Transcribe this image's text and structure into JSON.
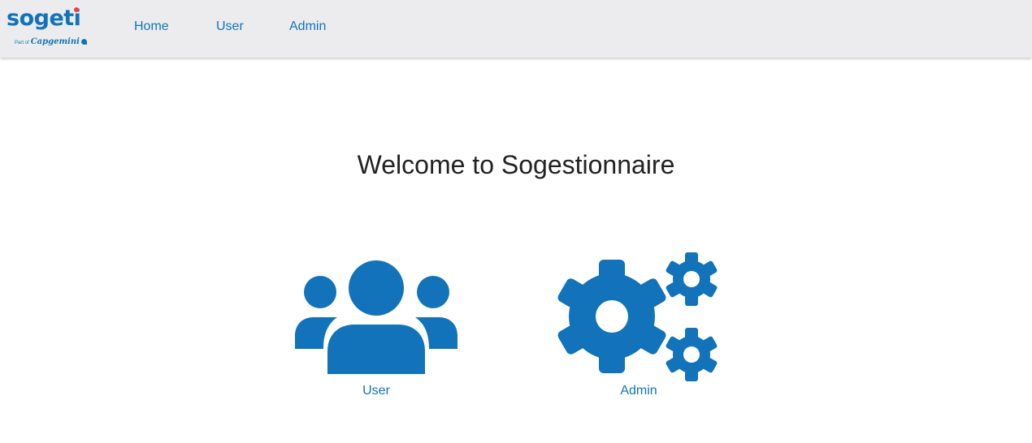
{
  "app": {
    "brand": "sogeti",
    "brand_sub_prefix": "Part of",
    "brand_sub": "Capgemini",
    "colors": {
      "primary": "#1273ba",
      "header_bg": "#ececee",
      "dot": "#e8413c"
    }
  },
  "nav": {
    "items": [
      {
        "label": "Home"
      },
      {
        "label": "User"
      },
      {
        "label": "Admin"
      }
    ]
  },
  "main": {
    "title": "Welcome to Sogestionnaire",
    "tiles": [
      {
        "label": "User",
        "icon": "users-icon"
      },
      {
        "label": "Admin",
        "icon": "gears-icon"
      }
    ]
  }
}
